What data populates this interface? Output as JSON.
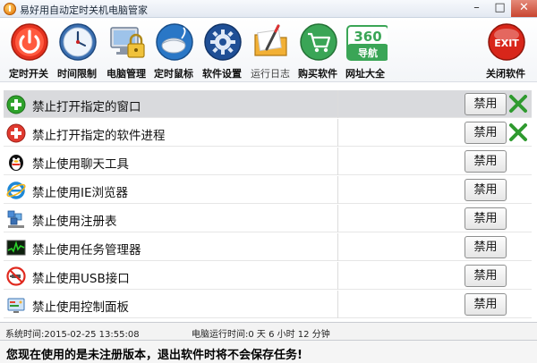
{
  "window": {
    "title": "易好用自动定时关机电脑管家"
  },
  "toolbar": {
    "items": [
      {
        "label": "定时开关"
      },
      {
        "label": "时间限制"
      },
      {
        "label": "电脑管理"
      },
      {
        "label": "定时鼠标"
      },
      {
        "label": "软件设置"
      },
      {
        "label": "运行日志"
      },
      {
        "label": "购买软件"
      },
      {
        "label": "网址大全"
      },
      {
        "label": "关闭软件"
      }
    ],
    "nav360_text": "360",
    "nav360_sub": "导航",
    "exit_text": "EXIT"
  },
  "rows": [
    {
      "label": "禁止打开指定的窗口",
      "button": "禁用"
    },
    {
      "label": "禁止打开指定的软件进程",
      "button": "禁用"
    },
    {
      "label": "禁止使用聊天工具",
      "button": "禁用"
    },
    {
      "label": "禁止使用IE浏览器",
      "button": "禁用"
    },
    {
      "label": "禁止使用注册表",
      "button": "禁用"
    },
    {
      "label": "禁止使用任务管理器",
      "button": "禁用"
    },
    {
      "label": "禁止使用USB接口",
      "button": "禁用"
    },
    {
      "label": "禁止使用控制面板",
      "button": "禁用"
    }
  ],
  "status": {
    "system_time": "系统时间:2015-02-25 13:55:08",
    "uptime": "电脑运行时间:0 天 6 小时 12 分钟"
  },
  "notice": "您现在使用的是未注册版本，退出软件时将不会保存任务!",
  "colors": {
    "accent_blue": "#1f5fa8",
    "power_red": "#e5321f",
    "selected_row": "#d9dadd",
    "add_green": "#2ea22b",
    "x_green": "#2f9a2f"
  }
}
